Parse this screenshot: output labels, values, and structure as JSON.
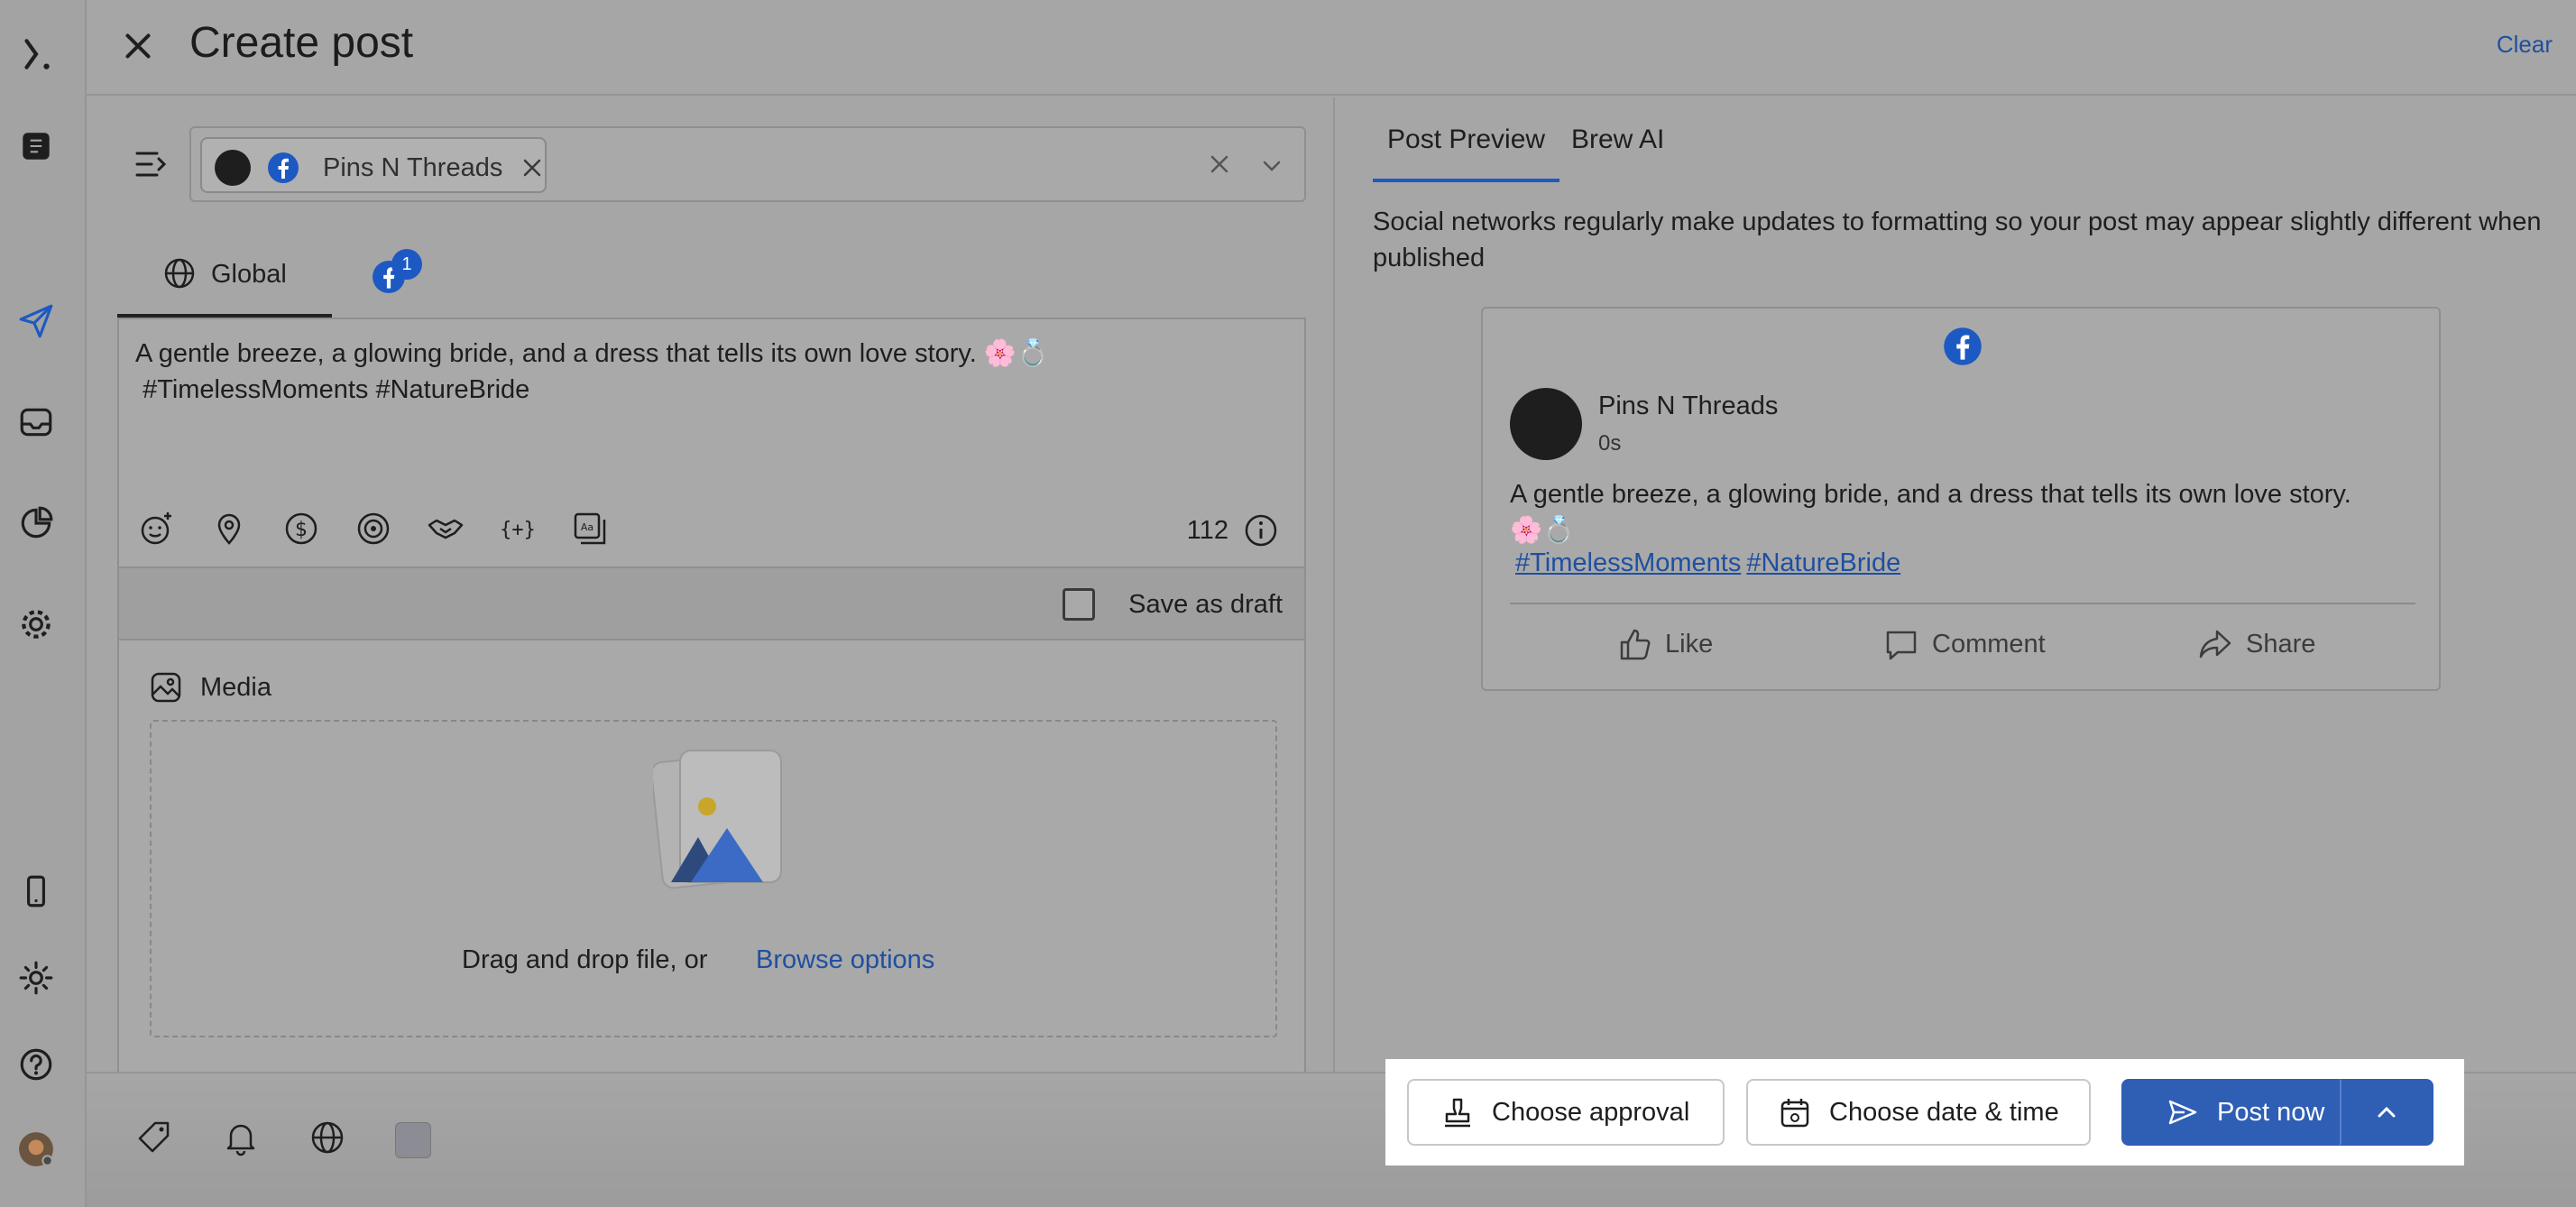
{
  "header": {
    "title": "Create post",
    "clear_label": "Clear"
  },
  "rail": {
    "icons": [
      "brand-logo-icon",
      "page-icon",
      "send-icon",
      "inbox-icon",
      "analytics-icon",
      "settings-icon",
      "mobile-icon",
      "theme-icon",
      "help-icon",
      "user-avatar"
    ]
  },
  "profile_select": {
    "chip_label": "Pins N Threads"
  },
  "editor_tabs": {
    "global_label": "Global",
    "facebook_badge": "1"
  },
  "editor": {
    "text_line1": "A gentle breeze, a glowing bride, and a dress that tells its own love story. 🌸💍",
    "text_line2": " #TimelessMoments #NatureBride",
    "char_count": "112"
  },
  "draft": {
    "label": "Save as draft"
  },
  "media": {
    "label": "Media",
    "drop_text": "Drag and drop file, or",
    "browse_label": "Browse options"
  },
  "preview": {
    "tab_preview": "Post Preview",
    "tab_brew": "Brew AI",
    "note": "Social networks regularly make updates to formatting so your post may appear slightly different when published",
    "page_name": "Pins N Threads",
    "time": "0s",
    "text_line1": "A gentle breeze, a glowing bride, and a dress that tells its own love story.",
    "text_line2": "🌸💍",
    "tag1": "#TimelessMoments",
    "tag2": "#NatureBride",
    "like": "Like",
    "comment": "Comment",
    "share": "Share"
  },
  "actions": {
    "approval_label": "Choose approval",
    "date_label": "Choose date & time",
    "post_label": "Post now"
  },
  "colors": {
    "accent": "#2f5eb5",
    "link": "#1f4fa0",
    "facebook": "#1d59c2"
  }
}
